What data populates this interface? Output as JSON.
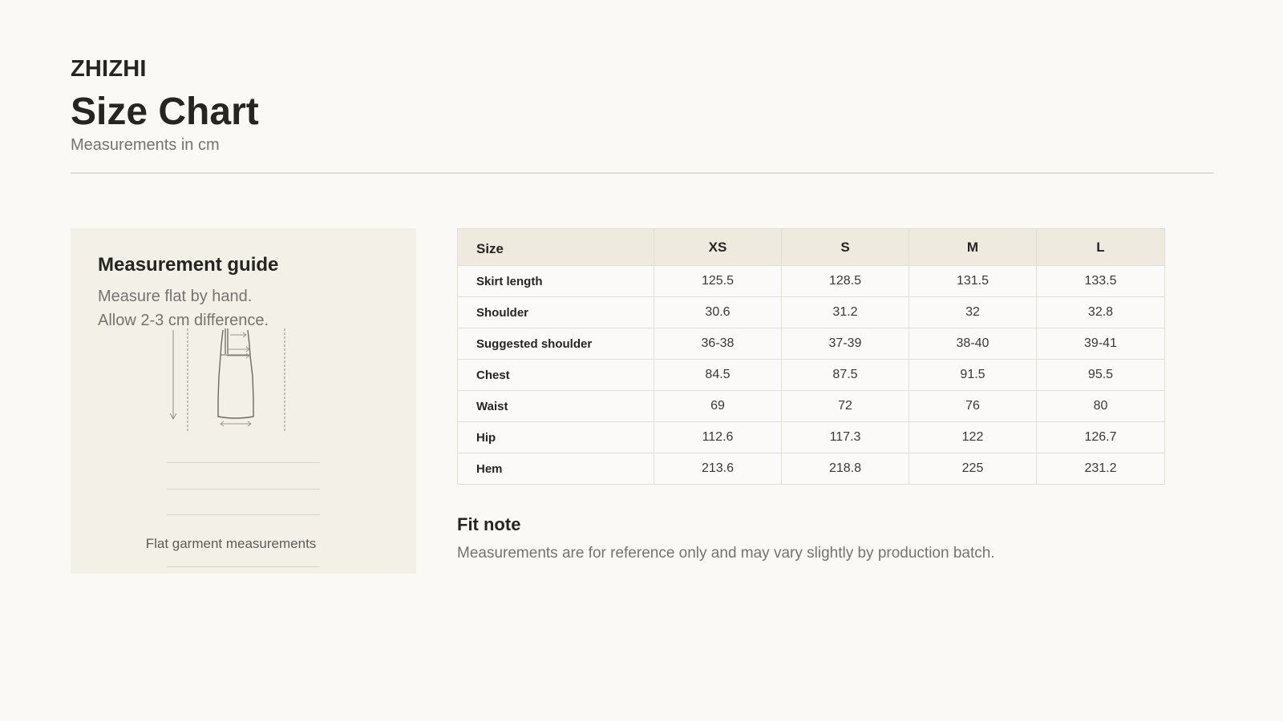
{
  "header": {
    "brand": "ZHIZHI",
    "title": "Size Chart",
    "subtitle": "Measurements in cm"
  },
  "guide": {
    "title": "Measurement guide",
    "lines": [
      "Measure flat by hand.",
      "Allow 2-3 cm difference."
    ],
    "illustration_icon": "dress-measurement-diagram-icon",
    "caption": "Flat garment measurements"
  },
  "table": {
    "columns": [
      "Size",
      "XS",
      "S",
      "M",
      "L"
    ],
    "rows": [
      {
        "label": "Skirt length",
        "values": [
          "125.5",
          "128.5",
          "131.5",
          "133.5"
        ]
      },
      {
        "label": "Shoulder",
        "values": [
          "30.6",
          "31.2",
          "32",
          "32.8"
        ]
      },
      {
        "label": "Suggested shoulder",
        "values": [
          "36-38",
          "37-39",
          "38-40",
          "39-41"
        ]
      },
      {
        "label": "Chest",
        "values": [
          "84.5",
          "87.5",
          "91.5",
          "95.5"
        ]
      },
      {
        "label": "Waist",
        "values": [
          "69",
          "72",
          "76",
          "80"
        ]
      },
      {
        "label": "Hip",
        "values": [
          "112.6",
          "117.3",
          "122",
          "126.7"
        ]
      },
      {
        "label": "Hem",
        "values": [
          "213.6",
          "218.8",
          "225",
          "231.2"
        ]
      }
    ]
  },
  "fit_note": {
    "title": "Fit note",
    "text": "Measurements are for reference only and may vary slightly by production batch."
  }
}
